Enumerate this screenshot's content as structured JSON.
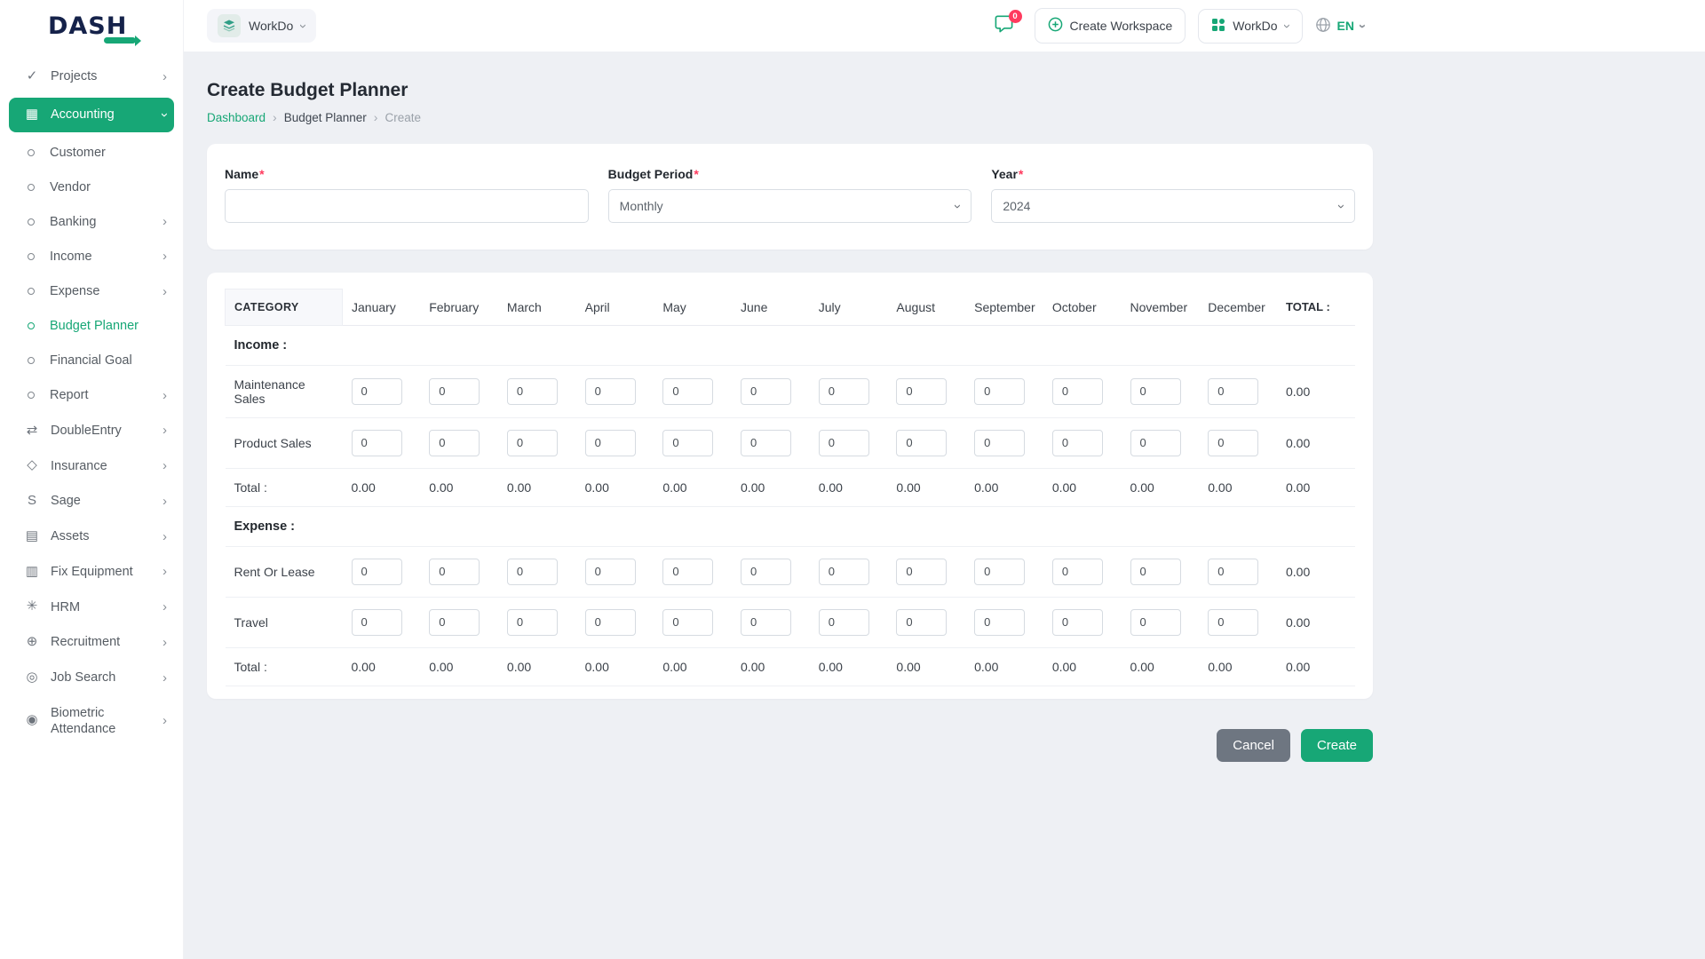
{
  "colors": {
    "accent": "#17a776",
    "badge": "#ff3a5e",
    "cancel_button": "#6e7681"
  },
  "header": {
    "logo": "DASH",
    "workspace_label": "WorkDo",
    "messages_badge": "0",
    "create_workspace_label": "Create Workspace",
    "workdo_label": "WorkDo",
    "language": "EN"
  },
  "sidebar": {
    "items": [
      {
        "label": "Projects",
        "glyph": "✓",
        "chevron": true
      },
      {
        "label": "Accounting",
        "glyph": "▦",
        "chevron": true,
        "active": true,
        "expanded": true
      },
      {
        "label": "Customer",
        "sub": true
      },
      {
        "label": "Vendor",
        "sub": true
      },
      {
        "label": "Banking",
        "sub": true,
        "chevron": true
      },
      {
        "label": "Income",
        "sub": true,
        "chevron": true
      },
      {
        "label": "Expense",
        "sub": true,
        "chevron": true
      },
      {
        "label": "Budget Planner",
        "sub": true,
        "active_sub": true
      },
      {
        "label": "Financial Goal",
        "sub": true
      },
      {
        "label": "Report",
        "sub": true,
        "chevron": true
      },
      {
        "label": "DoubleEntry",
        "glyph": "⇄",
        "chevron": true
      },
      {
        "label": "Insurance",
        "glyph": "◇",
        "chevron": true
      },
      {
        "label": "Sage",
        "glyph": "S",
        "chevron": true
      },
      {
        "label": "Assets",
        "glyph": "▤",
        "chevron": true
      },
      {
        "label": "Fix Equipment",
        "glyph": "▥",
        "chevron": true
      },
      {
        "label": "HRM",
        "glyph": "✳",
        "chevron": true
      },
      {
        "label": "Recruitment",
        "glyph": "⊕",
        "chevron": true
      },
      {
        "label": "Job Search",
        "glyph": "◎",
        "chevron": true
      },
      {
        "label": "Biometric Attendance",
        "glyph": "◉",
        "chevron": true
      }
    ]
  },
  "page": {
    "title": "Create Budget Planner",
    "breadcrumb": [
      {
        "label": "Dashboard",
        "type": "link"
      },
      {
        "label": "Budget Planner",
        "type": "current"
      },
      {
        "label": "Create",
        "type": "muted"
      }
    ]
  },
  "form": {
    "name_label": "Name",
    "period_label": "Budget Period",
    "period_value": "Monthly",
    "year_label": "Year",
    "year_value": "2024",
    "required_mark": "*"
  },
  "table": {
    "category_header": "CATEGORY",
    "total_header": "TOTAL :",
    "months": [
      "January",
      "February",
      "March",
      "April",
      "May",
      "June",
      "July",
      "August",
      "September",
      "October",
      "November",
      "December"
    ],
    "sections": [
      {
        "title": "Income :",
        "rows": [
          {
            "label": "Maintenance Sales",
            "values": [
              "0",
              "0",
              "0",
              "0",
              "0",
              "0",
              "0",
              "0",
              "0",
              "0",
              "0",
              "0"
            ],
            "total": "0.00"
          },
          {
            "label": "Product Sales",
            "values": [
              "0",
              "0",
              "0",
              "0",
              "0",
              "0",
              "0",
              "0",
              "0",
              "0",
              "0",
              "0"
            ],
            "total": "0.00"
          }
        ],
        "total_row": {
          "label": "Total :",
          "values": [
            "0.00",
            "0.00",
            "0.00",
            "0.00",
            "0.00",
            "0.00",
            "0.00",
            "0.00",
            "0.00",
            "0.00",
            "0.00",
            "0.00"
          ],
          "total": "0.00"
        }
      },
      {
        "title": "Expense :",
        "rows": [
          {
            "label": "Rent Or Lease",
            "values": [
              "0",
              "0",
              "0",
              "0",
              "0",
              "0",
              "0",
              "0",
              "0",
              "0",
              "0",
              "0"
            ],
            "total": "0.00"
          },
          {
            "label": "Travel",
            "values": [
              "0",
              "0",
              "0",
              "0",
              "0",
              "0",
              "0",
              "0",
              "0",
              "0",
              "0",
              "0"
            ],
            "total": "0.00"
          }
        ],
        "total_row": {
          "label": "Total :",
          "values": [
            "0.00",
            "0.00",
            "0.00",
            "0.00",
            "0.00",
            "0.00",
            "0.00",
            "0.00",
            "0.00",
            "0.00",
            "0.00",
            "0.00"
          ],
          "total": "0.00"
        }
      }
    ]
  },
  "actions": {
    "cancel": "Cancel",
    "create": "Create"
  }
}
